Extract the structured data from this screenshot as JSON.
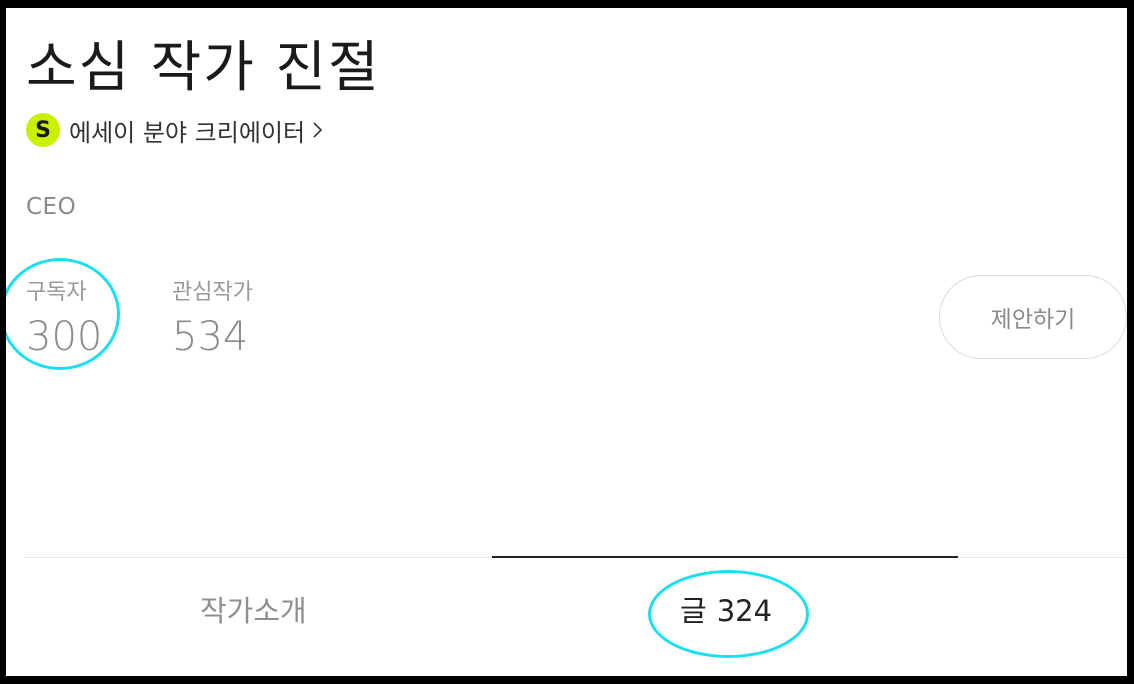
{
  "profile": {
    "name": "소심 작가 진절",
    "category": {
      "badge": "S",
      "label": "에세이 분야 크리에이터",
      "badge_color": "#c8f000"
    },
    "job_title": "CEO"
  },
  "stats": {
    "subscribers": {
      "label": "구독자",
      "value": "300"
    },
    "following": {
      "label": "관심작가",
      "value": "534"
    }
  },
  "actions": {
    "propose_label": "제안하기"
  },
  "tabs": {
    "about": {
      "label": "작가소개"
    },
    "posts": {
      "label": "글",
      "count": "324"
    }
  },
  "annotation_color": "#19e0f0"
}
